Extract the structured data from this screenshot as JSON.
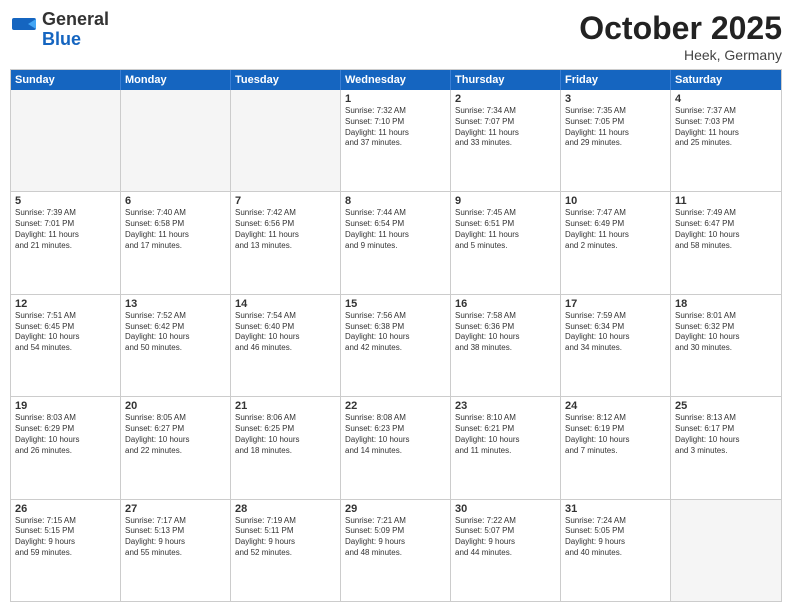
{
  "header": {
    "logo": {
      "general": "General",
      "blue": "Blue"
    },
    "title": "October 2025",
    "location": "Heek, Germany"
  },
  "weekdays": [
    "Sunday",
    "Monday",
    "Tuesday",
    "Wednesday",
    "Thursday",
    "Friday",
    "Saturday"
  ],
  "weeks": [
    [
      {
        "day": "",
        "text": "",
        "empty": true
      },
      {
        "day": "",
        "text": "",
        "empty": true
      },
      {
        "day": "",
        "text": "",
        "empty": true
      },
      {
        "day": "1",
        "text": "Sunrise: 7:32 AM\nSunset: 7:10 PM\nDaylight: 11 hours\nand 37 minutes."
      },
      {
        "day": "2",
        "text": "Sunrise: 7:34 AM\nSunset: 7:07 PM\nDaylight: 11 hours\nand 33 minutes."
      },
      {
        "day": "3",
        "text": "Sunrise: 7:35 AM\nSunset: 7:05 PM\nDaylight: 11 hours\nand 29 minutes."
      },
      {
        "day": "4",
        "text": "Sunrise: 7:37 AM\nSunset: 7:03 PM\nDaylight: 11 hours\nand 25 minutes."
      }
    ],
    [
      {
        "day": "5",
        "text": "Sunrise: 7:39 AM\nSunset: 7:01 PM\nDaylight: 11 hours\nand 21 minutes."
      },
      {
        "day": "6",
        "text": "Sunrise: 7:40 AM\nSunset: 6:58 PM\nDaylight: 11 hours\nand 17 minutes."
      },
      {
        "day": "7",
        "text": "Sunrise: 7:42 AM\nSunset: 6:56 PM\nDaylight: 11 hours\nand 13 minutes."
      },
      {
        "day": "8",
        "text": "Sunrise: 7:44 AM\nSunset: 6:54 PM\nDaylight: 11 hours\nand 9 minutes."
      },
      {
        "day": "9",
        "text": "Sunrise: 7:45 AM\nSunset: 6:51 PM\nDaylight: 11 hours\nand 5 minutes."
      },
      {
        "day": "10",
        "text": "Sunrise: 7:47 AM\nSunset: 6:49 PM\nDaylight: 11 hours\nand 2 minutes."
      },
      {
        "day": "11",
        "text": "Sunrise: 7:49 AM\nSunset: 6:47 PM\nDaylight: 10 hours\nand 58 minutes."
      }
    ],
    [
      {
        "day": "12",
        "text": "Sunrise: 7:51 AM\nSunset: 6:45 PM\nDaylight: 10 hours\nand 54 minutes."
      },
      {
        "day": "13",
        "text": "Sunrise: 7:52 AM\nSunset: 6:42 PM\nDaylight: 10 hours\nand 50 minutes."
      },
      {
        "day": "14",
        "text": "Sunrise: 7:54 AM\nSunset: 6:40 PM\nDaylight: 10 hours\nand 46 minutes."
      },
      {
        "day": "15",
        "text": "Sunrise: 7:56 AM\nSunset: 6:38 PM\nDaylight: 10 hours\nand 42 minutes."
      },
      {
        "day": "16",
        "text": "Sunrise: 7:58 AM\nSunset: 6:36 PM\nDaylight: 10 hours\nand 38 minutes."
      },
      {
        "day": "17",
        "text": "Sunrise: 7:59 AM\nSunset: 6:34 PM\nDaylight: 10 hours\nand 34 minutes."
      },
      {
        "day": "18",
        "text": "Sunrise: 8:01 AM\nSunset: 6:32 PM\nDaylight: 10 hours\nand 30 minutes."
      }
    ],
    [
      {
        "day": "19",
        "text": "Sunrise: 8:03 AM\nSunset: 6:29 PM\nDaylight: 10 hours\nand 26 minutes."
      },
      {
        "day": "20",
        "text": "Sunrise: 8:05 AM\nSunset: 6:27 PM\nDaylight: 10 hours\nand 22 minutes."
      },
      {
        "day": "21",
        "text": "Sunrise: 8:06 AM\nSunset: 6:25 PM\nDaylight: 10 hours\nand 18 minutes."
      },
      {
        "day": "22",
        "text": "Sunrise: 8:08 AM\nSunset: 6:23 PM\nDaylight: 10 hours\nand 14 minutes."
      },
      {
        "day": "23",
        "text": "Sunrise: 8:10 AM\nSunset: 6:21 PM\nDaylight: 10 hours\nand 11 minutes."
      },
      {
        "day": "24",
        "text": "Sunrise: 8:12 AM\nSunset: 6:19 PM\nDaylight: 10 hours\nand 7 minutes."
      },
      {
        "day": "25",
        "text": "Sunrise: 8:13 AM\nSunset: 6:17 PM\nDaylight: 10 hours\nand 3 minutes."
      }
    ],
    [
      {
        "day": "26",
        "text": "Sunrise: 7:15 AM\nSunset: 5:15 PM\nDaylight: 9 hours\nand 59 minutes."
      },
      {
        "day": "27",
        "text": "Sunrise: 7:17 AM\nSunset: 5:13 PM\nDaylight: 9 hours\nand 55 minutes."
      },
      {
        "day": "28",
        "text": "Sunrise: 7:19 AM\nSunset: 5:11 PM\nDaylight: 9 hours\nand 52 minutes."
      },
      {
        "day": "29",
        "text": "Sunrise: 7:21 AM\nSunset: 5:09 PM\nDaylight: 9 hours\nand 48 minutes."
      },
      {
        "day": "30",
        "text": "Sunrise: 7:22 AM\nSunset: 5:07 PM\nDaylight: 9 hours\nand 44 minutes."
      },
      {
        "day": "31",
        "text": "Sunrise: 7:24 AM\nSunset: 5:05 PM\nDaylight: 9 hours\nand 40 minutes."
      },
      {
        "day": "",
        "text": "",
        "empty": true
      }
    ]
  ]
}
